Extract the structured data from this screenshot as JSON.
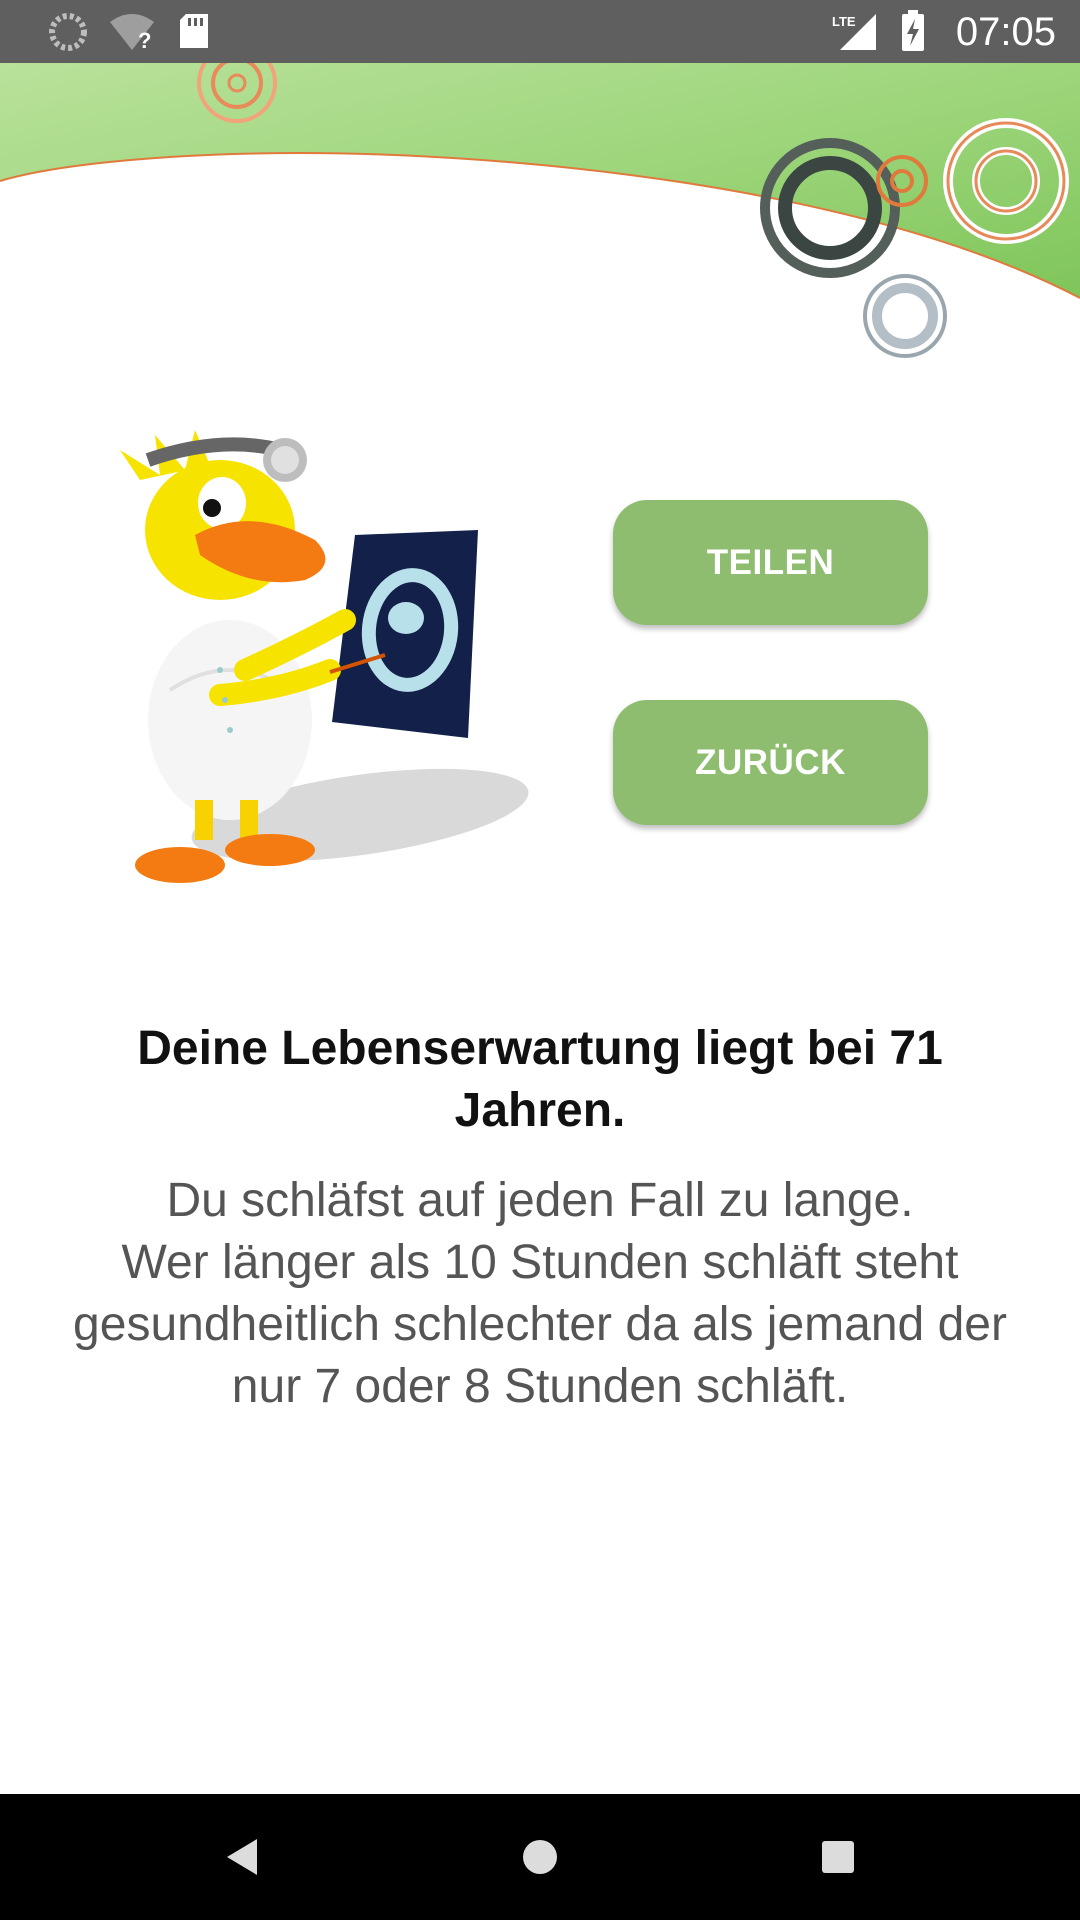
{
  "status_bar": {
    "time": "07:05",
    "network": "LTE",
    "icons": [
      "loading-icon",
      "wifi-unknown-icon",
      "sd-card-icon",
      "signal-icon",
      "battery-charging-icon"
    ]
  },
  "actions": {
    "share_label": "TEILEN",
    "back_label": "ZURÜCK"
  },
  "result": {
    "title": "Deine Lebenserwartung liegt bei 71 Jahren.",
    "description": "Du schläfst auf jeden Fall zu lange.\nWer länger als 10 Stunden schläft steht gesundheitlich schlechter da als jemand der nur 7 oder 8 Stunden schläft."
  },
  "colors": {
    "accent_green": "#8fbd70",
    "status_bar": "#5f5f5f",
    "nav_bar": "#000000"
  },
  "navigation": {
    "icons": [
      "back-icon",
      "home-icon",
      "recents-icon"
    ]
  }
}
